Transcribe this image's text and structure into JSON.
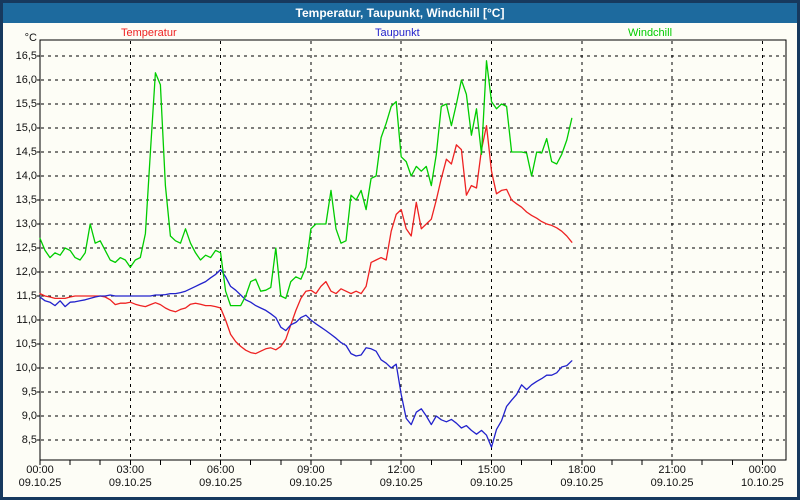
{
  "window": {
    "title": "Temperatur, Taupunkt, Windchill [°C]"
  },
  "legend": [
    {
      "label": "Temperatur",
      "color": "#ee2222"
    },
    {
      "label": "Taupunkt",
      "color": "#2222cc"
    },
    {
      "label": "Windchill",
      "color": "#00cc00"
    }
  ],
  "colors": {
    "titlebar_bg": "#1d6a9e",
    "window_border": "#17395e",
    "grid": "#000000",
    "temperatur": "#ee2222",
    "taupunkt": "#2222cc",
    "windchill": "#00cc00"
  },
  "chart_data": {
    "type": "line",
    "title": "Temperatur, Taupunkt, Windchill [°C]",
    "xlabel": "",
    "ylabel": "°C",
    "ylim": [
      8.1,
      16.8
    ],
    "grid": true,
    "legend_position": "top",
    "y_axis": {
      "tick_values": [
        16.5,
        16.0,
        15.5,
        15.0,
        14.5,
        14.0,
        13.5,
        13.0,
        12.5,
        12.0,
        11.5,
        11.0,
        10.5,
        10.0,
        9.5,
        9.0,
        8.5
      ],
      "tick_labels": [
        "16,5",
        "16,0",
        "15,5",
        "15,0",
        "14,5",
        "14,0",
        "13,5",
        "13,0",
        "12,5",
        "12,0",
        "11,5",
        "11,0",
        "10,5",
        "10,0",
        "9,5",
        "9,0",
        "8,5"
      ]
    },
    "x_axis": {
      "range_hours": [
        0,
        24.77
      ],
      "major_tick_hours": [
        0,
        3,
        6,
        9,
        12,
        15,
        18,
        21,
        24
      ],
      "minor_tick_interval_hours": 1,
      "time_labels": [
        "00:00",
        "03:00",
        "06:00",
        "09:00",
        "12:00",
        "15:00",
        "18:00",
        "21:00",
        "00:00"
      ],
      "date_labels": [
        "09.10.25",
        "09.10.25",
        "09.10.25",
        "09.10.25",
        "09.10.25",
        "09.10.25",
        "09.10.25",
        "09.10.25",
        "10.10.25"
      ]
    },
    "sampling": {
      "start_minutes": 0,
      "interval_minutes": 10,
      "data_end_time": "17:40"
    },
    "series": [
      {
        "name": "Temperatur",
        "color": "#ee2222",
        "values": [
          11.55,
          11.5,
          11.48,
          11.45,
          11.45,
          11.45,
          11.48,
          11.5,
          11.5,
          11.5,
          11.5,
          11.5,
          11.5,
          11.48,
          11.42,
          11.32,
          11.35,
          11.35,
          11.37,
          11.33,
          11.3,
          11.28,
          11.32,
          11.36,
          11.32,
          11.25,
          11.2,
          11.17,
          11.22,
          11.25,
          11.33,
          11.35,
          11.33,
          11.3,
          11.3,
          11.28,
          11.25,
          11.0,
          10.7,
          10.55,
          10.45,
          10.37,
          10.32,
          10.3,
          10.35,
          10.4,
          10.42,
          10.38,
          10.45,
          10.6,
          10.9,
          11.2,
          11.45,
          11.6,
          11.62,
          11.55,
          11.7,
          11.8,
          11.6,
          11.55,
          11.65,
          11.6,
          11.55,
          11.6,
          11.55,
          11.7,
          12.2,
          12.25,
          12.3,
          12.25,
          12.85,
          13.2,
          13.3,
          12.9,
          12.75,
          13.45,
          12.9,
          13.0,
          13.1,
          13.5,
          13.95,
          14.35,
          14.25,
          14.65,
          14.55,
          13.6,
          13.8,
          13.75,
          14.55,
          15.05,
          14.1,
          13.63,
          13.7,
          13.72,
          13.5,
          13.42,
          13.35,
          13.25,
          13.18,
          13.12,
          13.05,
          13.0,
          12.97,
          12.92,
          12.85,
          12.75,
          12.62
        ]
      },
      {
        "name": "Taupunkt",
        "color": "#2222cc",
        "values": [
          11.48,
          11.4,
          11.37,
          11.3,
          11.4,
          11.28,
          11.37,
          11.38,
          11.4,
          11.42,
          11.45,
          11.48,
          11.5,
          11.5,
          11.52,
          11.5,
          11.5,
          11.5,
          11.5,
          11.5,
          11.5,
          11.5,
          11.5,
          11.52,
          11.52,
          11.53,
          11.55,
          11.55,
          11.57,
          11.6,
          11.65,
          11.7,
          11.75,
          11.8,
          11.88,
          11.95,
          12.05,
          11.9,
          11.7,
          11.62,
          11.52,
          11.42,
          11.37,
          11.3,
          11.25,
          11.2,
          11.13,
          11.05,
          10.85,
          10.78,
          10.9,
          10.95,
          11.05,
          11.1,
          11.0,
          10.92,
          10.85,
          10.78,
          10.7,
          10.62,
          10.53,
          10.47,
          10.3,
          10.25,
          10.27,
          10.42,
          10.4,
          10.35,
          10.17,
          10.1,
          10.0,
          10.08,
          9.45,
          8.95,
          8.82,
          9.08,
          9.15,
          9.0,
          8.82,
          9.0,
          8.92,
          8.88,
          8.93,
          8.85,
          8.75,
          8.8,
          8.7,
          8.62,
          8.7,
          8.6,
          8.35,
          8.72,
          8.9,
          9.2,
          9.33,
          9.45,
          9.65,
          9.55,
          9.65,
          9.72,
          9.78,
          9.85,
          9.85,
          9.9,
          10.02,
          10.05,
          10.15
        ]
      },
      {
        "name": "Windchill",
        "color": "#00cc00",
        "values": [
          12.7,
          12.45,
          12.3,
          12.4,
          12.35,
          12.5,
          12.45,
          12.3,
          12.25,
          12.4,
          13.0,
          12.6,
          12.65,
          12.45,
          12.25,
          12.2,
          12.3,
          12.25,
          12.1,
          12.25,
          12.3,
          12.8,
          14.5,
          16.15,
          15.9,
          13.8,
          12.75,
          12.65,
          12.6,
          12.9,
          12.6,
          12.4,
          12.25,
          12.35,
          12.3,
          12.45,
          12.4,
          11.6,
          11.3,
          11.3,
          11.3,
          11.5,
          11.8,
          11.85,
          11.6,
          11.62,
          11.68,
          12.5,
          11.5,
          11.45,
          11.8,
          11.9,
          11.85,
          12.1,
          12.9,
          13.0,
          13.0,
          13.0,
          13.7,
          12.9,
          12.6,
          12.65,
          13.6,
          13.5,
          13.7,
          13.3,
          13.95,
          14.0,
          14.8,
          15.1,
          15.45,
          15.55,
          14.4,
          14.3,
          14.0,
          14.2,
          14.1,
          14.2,
          13.8,
          14.45,
          15.45,
          15.5,
          15.05,
          15.5,
          16.0,
          15.7,
          14.85,
          15.4,
          14.45,
          16.4,
          15.55,
          15.4,
          15.5,
          15.45,
          14.5,
          14.5,
          14.5,
          14.48,
          14.0,
          14.5,
          14.48,
          14.78,
          14.3,
          14.25,
          14.45,
          14.75,
          15.2
        ]
      }
    ]
  }
}
